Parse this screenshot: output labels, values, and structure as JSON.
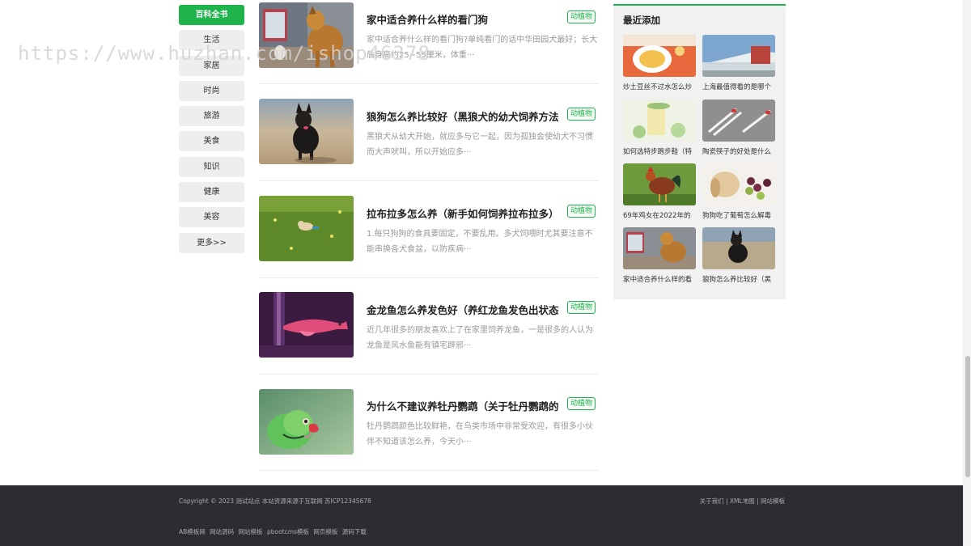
{
  "watermark": "https://www.huzhan.com/ishop46378",
  "categories": [
    {
      "label": "百科全书",
      "active": true
    },
    {
      "label": "生活"
    },
    {
      "label": "家居"
    },
    {
      "label": "时尚"
    },
    {
      "label": "旅游"
    },
    {
      "label": "美食"
    },
    {
      "label": "知识"
    },
    {
      "label": "健康"
    },
    {
      "label": "美容"
    },
    {
      "label": "更多>>"
    }
  ],
  "articles": [
    {
      "title": "家中适合养什么样的看门狗",
      "tag": "动植物",
      "desc": "家中适合养什么样的看门狗?单纯看门的话中华田园犬最好；长大后身高约25~55厘米，体重···"
    },
    {
      "title": "狼狗怎么养比较好（黑狼犬的幼犬饲养方法",
      "tag": "动植物",
      "desc": "黑狼犬从幼犬开始，就应多与它一起，因为孤独会使幼犬不习惯而大声吠叫，所以开始应多···"
    },
    {
      "title": "拉布拉多怎么养（新手如何饲养拉布拉多）",
      "tag": "动植物",
      "desc": "1.每只狗狗的食具要固定，不要乱用。多犬饲喂时尤其要注意不能串换各犬食盆，以防疾病···"
    },
    {
      "title": "金龙鱼怎么养发色好（养红龙鱼发色出状态",
      "tag": "动植物",
      "desc": "近几年很多的朋友喜欢上了在家里饲养龙鱼，一是很多的人认为龙鱼是风水鱼能有镇宅辟邪···"
    },
    {
      "title": "为什么不建议养牡丹鹦鹉（关于牡丹鹦鹉的",
      "tag": "动植物",
      "desc": "牡丹鹦鹉颜色比较鲜艳，在鸟类市场中非常受欢迎，有很多小伙伴不知道该怎么养，今天小···"
    }
  ],
  "sidebar": {
    "title": "最近添加",
    "items": [
      {
        "caption": "炒土豆丝不过水怎么炒",
        "icon": "noodle-plate-image"
      },
      {
        "caption": "上海最值得看的是哪个",
        "icon": "building-image"
      },
      {
        "caption": "如何选特步跑步鞋（特",
        "icon": "drink-glass-image"
      },
      {
        "caption": "陶瓷筷子的好处是什么",
        "icon": "chopsticks-image"
      },
      {
        "caption": "69年鸡女在2022年的",
        "icon": "rooster-image"
      },
      {
        "caption": "狗狗吃了葡萄怎么解毒",
        "icon": "dog-grapes-image"
      },
      {
        "caption": "家中适合养什么样的看",
        "icon": "guard-dog-image"
      },
      {
        "caption": "狼狗怎么养比较好（黑",
        "icon": "black-dog-image"
      }
    ]
  },
  "footer": {
    "copyright": "Copyright © 2023 测试站点 本站资源来源于互联网 苏ICP12345678",
    "right_links": "关于我们 | XML地图 | 网站模板",
    "bottom_links": [
      "AB模板网",
      "网站源码",
      "网站模板",
      "pbootcms模板",
      "网页模板",
      "源码下载"
    ]
  }
}
